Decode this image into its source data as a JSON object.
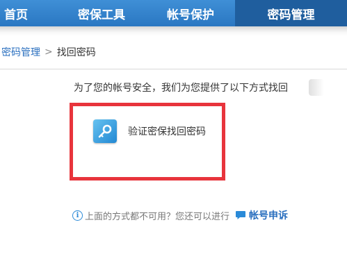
{
  "nav": {
    "tabs": [
      {
        "label": "首页"
      },
      {
        "label": "密保工具"
      },
      {
        "label": "帐号保护"
      },
      {
        "label": "密码管理",
        "active": true
      }
    ]
  },
  "breadcrumb": {
    "parent": "密码管理",
    "separator": ">",
    "current": "找回密码"
  },
  "intro": "为了您的帐号安全，我们为您提供了以下方式找回",
  "option": {
    "label": "验证密保找回密码",
    "icon": "key-icon"
  },
  "help": {
    "icon": "info-icon",
    "text": "上面的方式都不可用？您还可以进行",
    "appeal_icon": "chat-bubble-icon",
    "appeal_label": "帐号申诉"
  },
  "colors": {
    "nav_bg": "#3a88d0",
    "nav_active": "#1f5e9e",
    "highlight_border": "#e8343c",
    "link": "#2a6fbf"
  }
}
